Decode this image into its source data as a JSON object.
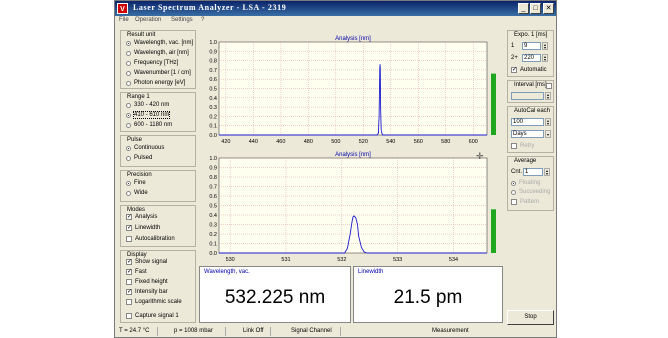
{
  "window": {
    "title": "Laser Spectrum Analyzer - LSA - 2319",
    "icon_letter": "V",
    "min": "_",
    "max": "□",
    "close": "✕"
  },
  "menu": [
    "File",
    "Operation",
    "Settings",
    "?"
  ],
  "result_unit": {
    "title": "Result unit",
    "options": [
      "Wavelength, vac. [nm]",
      "Wavelength, air [nm]",
      "Frequency [THz]",
      "Wavenumber [1 / cm]",
      "Photon energy [eV]"
    ],
    "selected": 0
  },
  "range": {
    "title": "Range 1",
    "options": [
      "330 - 420 nm",
      "410 - 610 nm",
      "600 - 1180 nm"
    ],
    "selected": 1
  },
  "pulse": {
    "title": "Pulse",
    "options": [
      "Continuous",
      "Pulsed"
    ],
    "selected": 0
  },
  "precision": {
    "title": "Precision",
    "options": [
      "Fine",
      "Wide"
    ],
    "selected": 0
  },
  "modes": {
    "title": "Modes",
    "items": [
      {
        "label": "Analysis",
        "checked": true
      },
      {
        "label": "Linewidth",
        "checked": true
      },
      {
        "label": "Autocalibration",
        "checked": false
      }
    ]
  },
  "display": {
    "title": "Display",
    "items": [
      {
        "label": "Show signal",
        "checked": true
      },
      {
        "label": "Fast",
        "checked": true
      },
      {
        "label": "Fixed height",
        "checked": false
      },
      {
        "label": "Intensity bar",
        "checked": true
      },
      {
        "label": "Logarithmic scale",
        "checked": false
      }
    ]
  },
  "capture": {
    "label": "Capture signal 1",
    "checked": false
  },
  "chart_data": [
    {
      "type": "line",
      "title": "Analysis [nm]",
      "xlim": [
        415,
        610
      ],
      "ylim": [
        0,
        1.0
      ],
      "xticks": [
        "420",
        "440",
        "460",
        "480",
        "500",
        "520",
        "540",
        "560",
        "580",
        "600"
      ],
      "yticks": [
        "0.0",
        "0.1",
        "0.2",
        "0.3",
        "0.4",
        "0.5",
        "0.6",
        "0.7",
        "0.8",
        "0.9",
        "1.0"
      ],
      "series": [
        {
          "x": [
            415,
            530,
            531,
            531.5,
            532,
            532.2,
            532.4,
            532.6,
            533,
            534,
            610
          ],
          "y": [
            0,
            0,
            0.02,
            0.2,
            0.72,
            0.76,
            0.7,
            0.3,
            0.05,
            0,
            0
          ]
        }
      ],
      "intensity": 0.66,
      "grid": true
    },
    {
      "type": "line",
      "title": "Analysis [nm]",
      "xlim": [
        529.8,
        534.6
      ],
      "ylim": [
        0,
        1.0
      ],
      "xticks": [
        "530",
        "531",
        "532",
        "533",
        "534"
      ],
      "yticks": [
        "0.0",
        "0.1",
        "0.2",
        "0.3",
        "0.4",
        "0.5",
        "0.6",
        "0.7",
        "0.8",
        "0.9",
        "1.0"
      ],
      "series": [
        {
          "x": [
            529.8,
            532.05,
            532.1,
            532.15,
            532.18,
            532.2,
            532.22,
            532.25,
            532.28,
            532.3,
            532.35,
            532.4,
            532.45,
            534.6
          ],
          "y": [
            0,
            0,
            0.05,
            0.2,
            0.32,
            0.38,
            0.39,
            0.37,
            0.3,
            0.18,
            0.06,
            0.01,
            0,
            0
          ]
        }
      ],
      "intensity": 0.46,
      "grid": true
    }
  ],
  "results": [
    {
      "label": "Wavelength, vac.",
      "value": "532.225 nm"
    },
    {
      "label": "Linewidth",
      "value": "21.5 pm"
    }
  ],
  "expo": {
    "title": "Expo. 1 [ms]",
    "rows": [
      {
        "label": "1",
        "value": "9"
      },
      {
        "label": "2+",
        "value": "220"
      }
    ],
    "automatic_label": "Automatic",
    "automatic": true
  },
  "interval": {
    "title": "Interval [ms]"
  },
  "autocal": {
    "title": "AutoCal each",
    "value": "100",
    "unit": "Days",
    "retry_label": "Retry"
  },
  "average": {
    "title": "Average",
    "cnt_label": "Cnt.",
    "cnt_value": "1",
    "modes": [
      "Floating",
      "Succeeding"
    ],
    "pattern_label": "Pattern"
  },
  "stop_label": "Stop",
  "status": [
    "T = 24.7 °C",
    "p = 1008 mbar",
    "Link Off",
    "Signal Channel",
    "Measurement"
  ],
  "colors": {
    "signal": "#1a1ad0",
    "grid": "#d49090",
    "bar": "#1fa81f",
    "plot_bg": "#fffff0"
  }
}
